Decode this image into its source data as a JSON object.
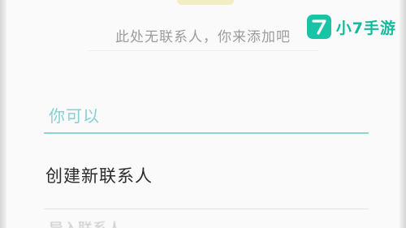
{
  "contacts": {
    "empty_message": "此处无联系人，你来添加吧",
    "section_header": "你可以",
    "actions": [
      {
        "label": "创建新联系人"
      },
      {
        "label": "导入联系人"
      }
    ]
  },
  "watermark": {
    "brand_text": "小7手游",
    "brand_glyph": "7",
    "brand_color": "#19c4a6"
  },
  "colors": {
    "accent": "#8fd6d8",
    "section_header_text": "#86cfd3",
    "primary_text": "#2b2b2b",
    "secondary_text": "#9c9c9c"
  }
}
